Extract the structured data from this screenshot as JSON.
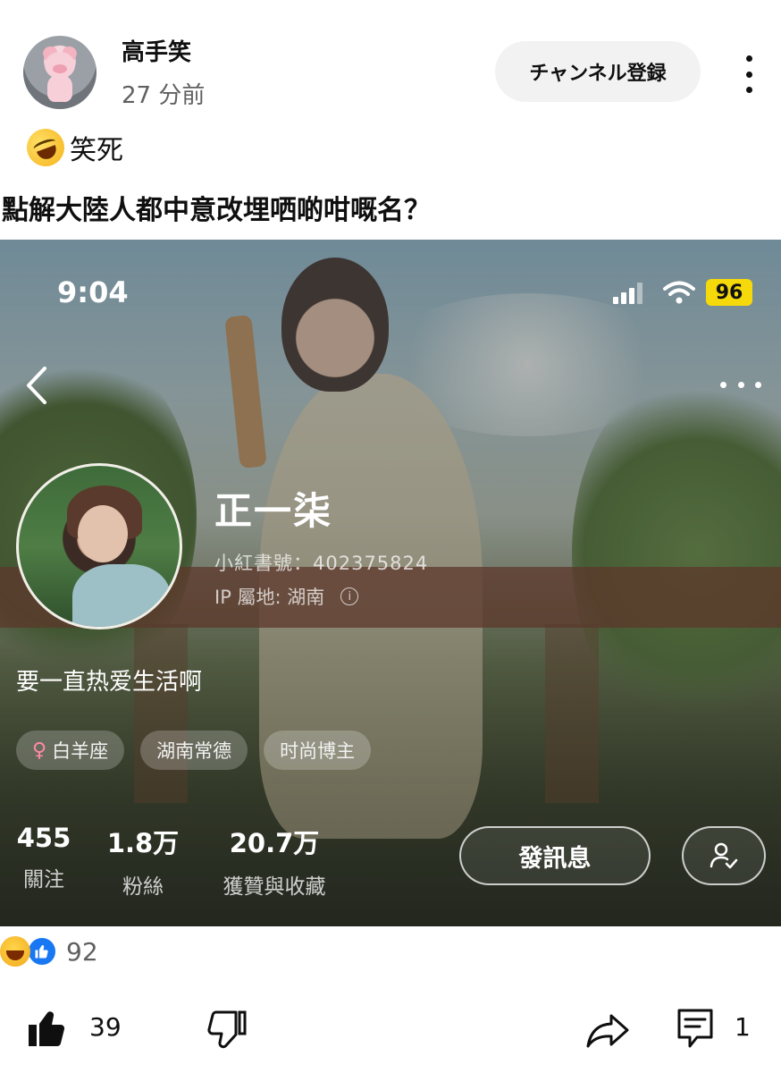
{
  "post": {
    "channel_name": "高手笑",
    "time_ago": "27 分前",
    "subscribe_label": "チャンネル登録",
    "caption": "笑死",
    "headline": "點解大陸人都中意改埋哂啲咁嘅名？"
  },
  "screenshot": {
    "status_time": "9:04",
    "battery": "96",
    "profile": {
      "name": "正一柒",
      "id_text": "小紅書號：402375824",
      "ip_text": "IP 屬地: 湖南",
      "bio": "要一直热爱生活啊",
      "tags": [
        "白羊座",
        "湖南常德",
        "时尚博主"
      ],
      "stats": [
        {
          "value": "455",
          "label": "關注"
        },
        {
          "value": "1.8万",
          "label": "粉絲"
        },
        {
          "value": "20.7万",
          "label": "獲贊與收藏"
        }
      ],
      "message_label": "發訊息"
    }
  },
  "engagement": {
    "reaction_count": "92",
    "like_count": "39",
    "comment_count": "1"
  },
  "icons": {
    "more": "more-vert-icon",
    "like": "thumb-up-icon",
    "dislike": "thumb-down-icon",
    "share": "share-icon",
    "comment": "comment-icon"
  },
  "colors": {
    "battery_badge": "#f5d90a",
    "react_like": "#1877f2"
  }
}
